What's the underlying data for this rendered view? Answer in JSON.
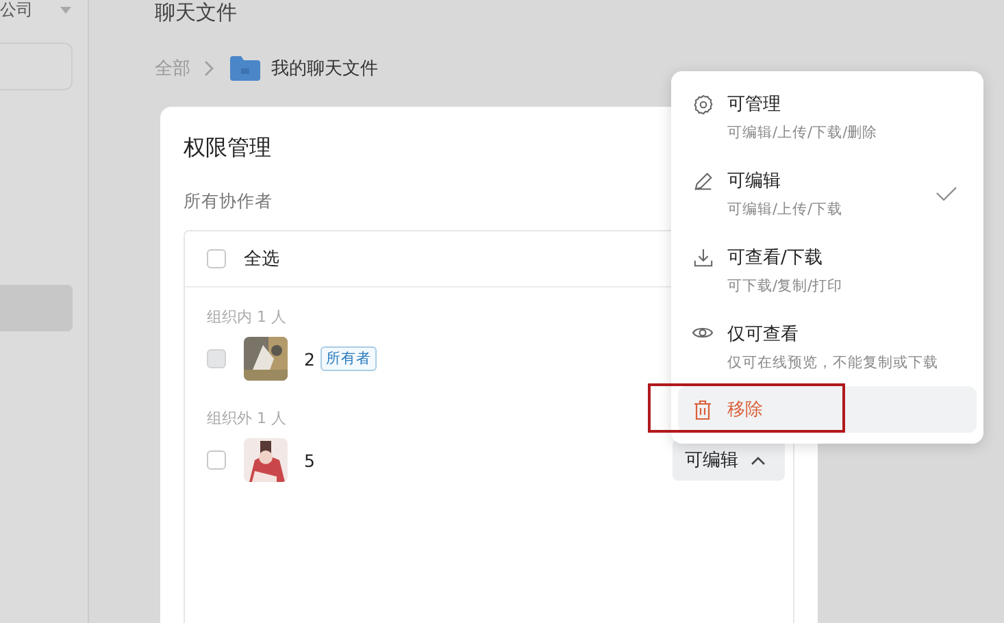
{
  "sidebar": {
    "org_name": "公司",
    "items": [
      {
        "selected": true
      }
    ]
  },
  "header": {
    "title": "聊天文件"
  },
  "breadcrumb": [
    {
      "label": "全部",
      "kind": "root"
    },
    {
      "label": "我的聊天文件",
      "kind": "folder"
    }
  ],
  "dialog": {
    "title": "权限管理",
    "section_label": "所有协作者",
    "select_all": {
      "label": "全选",
      "checked": false
    },
    "groups": [
      {
        "label": "组织内 1 人",
        "members": [
          {
            "name": "2",
            "tag": "所有者",
            "checked": false,
            "disabled": true
          }
        ]
      },
      {
        "label": "组织外 1 人",
        "members": [
          {
            "name": "5",
            "checked": false,
            "disabled": false,
            "role": "可编辑",
            "expanded": true
          }
        ]
      }
    ]
  },
  "menu": {
    "items": [
      {
        "kind": "manage",
        "label": "可管理",
        "description": "可编辑/上传/下载/删除",
        "selected": false,
        "highlighted": false
      },
      {
        "kind": "edit",
        "label": "可编辑",
        "description": "可编辑/上传/下载",
        "selected": true,
        "highlighted": false
      },
      {
        "kind": "download",
        "label": "可查看/下载",
        "description": "可下载/复制/打印",
        "selected": false,
        "highlighted": false
      },
      {
        "kind": "view",
        "label": "仅可查看",
        "description": "仅可在线预览，不能复制或下载",
        "selected": false,
        "highlighted": false
      },
      {
        "kind": "remove",
        "label": "移除",
        "selected": false,
        "highlighted": true
      }
    ]
  }
}
